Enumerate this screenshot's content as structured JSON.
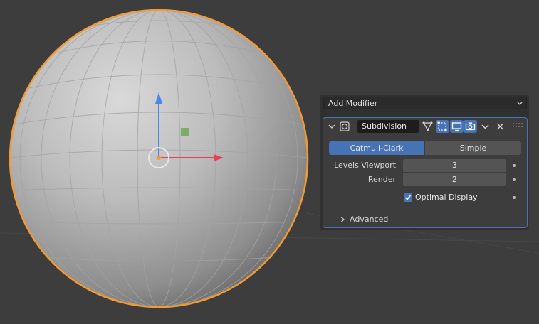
{
  "viewport": {
    "colors": {
      "background": "#3d3d3d",
      "selection_outline": "#f29a33",
      "z_axis": "#4d86e8",
      "x_axis": "#e8424e",
      "y_axis_handle": "#6fa85a"
    },
    "object_icon": "sphere-mesh",
    "gizmo_icon": "move-gizmo"
  },
  "panel": {
    "add_modifier": "Add Modifier",
    "modifier": {
      "name": "Subdivision",
      "type_icon": "subdivision-modifier-icon",
      "algorithm_options": [
        "Catmull-Clark",
        "Simple"
      ],
      "selected_algorithm": "Catmull-Clark",
      "levels_viewport_label": "Levels Viewport",
      "levels_viewport_value": "3",
      "render_label": "Render",
      "render_value": "2",
      "optimal_display_label": "Optimal Display",
      "optimal_display_checked": true,
      "advanced_label": "Advanced",
      "toggles": {
        "on_cage": false,
        "edit_mode": true,
        "viewport": true,
        "render": true
      }
    }
  }
}
